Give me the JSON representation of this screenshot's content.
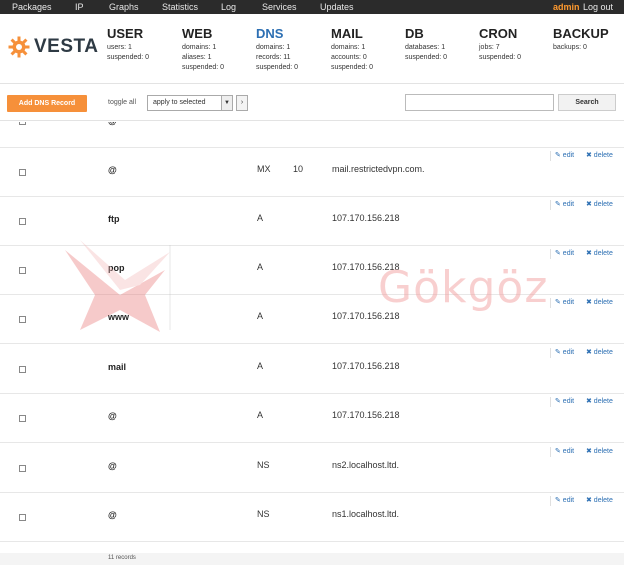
{
  "topnav": {
    "items": [
      "Packages",
      "IP",
      "Graphs",
      "Statistics",
      "Log",
      "Services",
      "Updates"
    ],
    "user": "admin",
    "logout": "Log out"
  },
  "brand": {
    "name": "VESTA"
  },
  "stats": [
    {
      "title": "USER",
      "lines": [
        "users: 1",
        "suspended: 0"
      ]
    },
    {
      "title": "WEB",
      "lines": [
        "domains: 1",
        "aliases: 1",
        "suspended: 0"
      ]
    },
    {
      "title": "DNS",
      "lines": [
        "domains: 1",
        "records: 11",
        "suspended: 0"
      ]
    },
    {
      "title": "MAIL",
      "lines": [
        "domains: 1",
        "accounts: 0",
        "suspended: 0"
      ]
    },
    {
      "title": "DB",
      "lines": [
        "databases: 1",
        "suspended: 0"
      ]
    },
    {
      "title": "CRON",
      "lines": [
        "jobs: 7",
        "suspended: 0"
      ]
    },
    {
      "title": "BACKUP",
      "lines": [
        "backups: 0"
      ]
    }
  ],
  "toolbar": {
    "add_label": "Add DNS Record",
    "toggle_label": "toggle all",
    "select_value": "apply to selected",
    "apply_glyph": "›",
    "search_label": "Search"
  },
  "partial_row": {
    "record": "@"
  },
  "records": [
    {
      "record": "@",
      "type": "MX",
      "priority": "10",
      "value": "mail.restrictedvpn.com."
    },
    {
      "record": "ftp",
      "type": "A",
      "priority": "",
      "value": "107.170.156.218"
    },
    {
      "record": "pop",
      "type": "A",
      "priority": "",
      "value": "107.170.156.218"
    },
    {
      "record": "www",
      "type": "A",
      "priority": "",
      "value": "107.170.156.218"
    },
    {
      "record": "mail",
      "type": "A",
      "priority": "",
      "value": "107.170.156.218"
    },
    {
      "record": "@",
      "type": "A",
      "priority": "",
      "value": "107.170.156.218"
    },
    {
      "record": "@",
      "type": "NS",
      "priority": "",
      "value": "ns2.localhost.ltd."
    },
    {
      "record": "@",
      "type": "NS",
      "priority": "",
      "value": "ns1.localhost.ltd."
    }
  ],
  "actions": {
    "edit": "✎ edit",
    "delete": "✖ delete"
  },
  "footer": {
    "count": "11 records"
  },
  "watermark": {
    "text": "Gökgöz"
  },
  "colors": {
    "accent": "#f6903a",
    "active_tab": "#2c6fb3",
    "topbar": "#2b2b2b"
  }
}
